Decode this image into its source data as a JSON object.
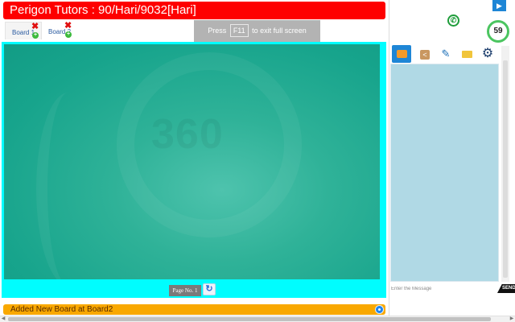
{
  "header": {
    "title": "Perigon Tutors : 90/Hari/9032[Hari]"
  },
  "tabs": [
    {
      "label": "Board 1",
      "close_glyph": "✖",
      "add_glyph": "+"
    },
    {
      "label": "Board 2",
      "close_glyph": "✖",
      "add_glyph": "+"
    }
  ],
  "fullscreen_notice": {
    "prefix": "Press",
    "key": "F11",
    "suffix": "to exit full screen"
  },
  "board": {
    "watermark": "360",
    "page_label": "Page No. 1",
    "refresh_glyph": "↻"
  },
  "status": {
    "message": "Added New Board at Board2"
  },
  "right_panel": {
    "timer": "59",
    "phone_glyph": "✆",
    "collapse_glyph": "▶",
    "tools": {
      "share_glyph": "<",
      "attach_glyph": "✎",
      "gear_glyph": "⚙"
    },
    "message_placeholder": "Enter the Message",
    "send_label": "SEND"
  },
  "scrollbar": {
    "left_arrow": "◀",
    "right_arrow": "▶"
  },
  "colors": {
    "title_red": "#fe0000",
    "board_cyan": "#00fdfe",
    "board_teal": "#17a48c",
    "status_orange": "#f9a800",
    "accent_blue": "#1e86d6"
  }
}
